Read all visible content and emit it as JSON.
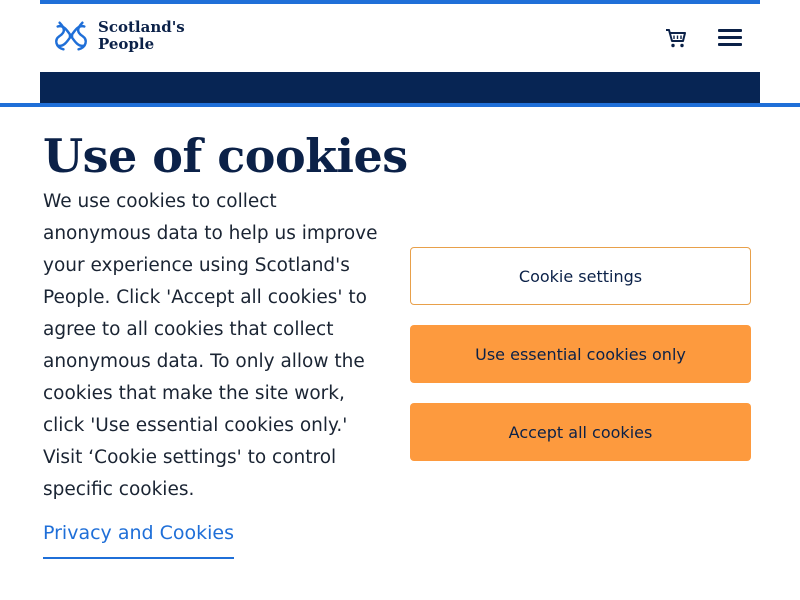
{
  "header": {
    "logo_line1": "Scotland's",
    "logo_line2": "People",
    "cart_icon": "cart-icon",
    "menu_icon": "hamburger-menu-icon"
  },
  "banner": {
    "title": "Use of cookies",
    "body": "We use cookies to collect anonymous data to help us improve your experience using Scotland's People. Click 'Accept all cookies' to agree to all cookies that collect anonymous data. To only allow the cookies that make the site work, click 'Use essential cookies only.' Visit ‘Cookie settings' to control specific cookies.",
    "privacy_link": "Privacy and Cookies"
  },
  "buttons": {
    "settings": "Cookie settings",
    "essential": "Use essential cookies only",
    "accept": "Accept all cookies"
  },
  "colors": {
    "brand_navy": "#072554",
    "accent_blue": "#1f6fd8",
    "button_orange": "#fd9a3e"
  }
}
